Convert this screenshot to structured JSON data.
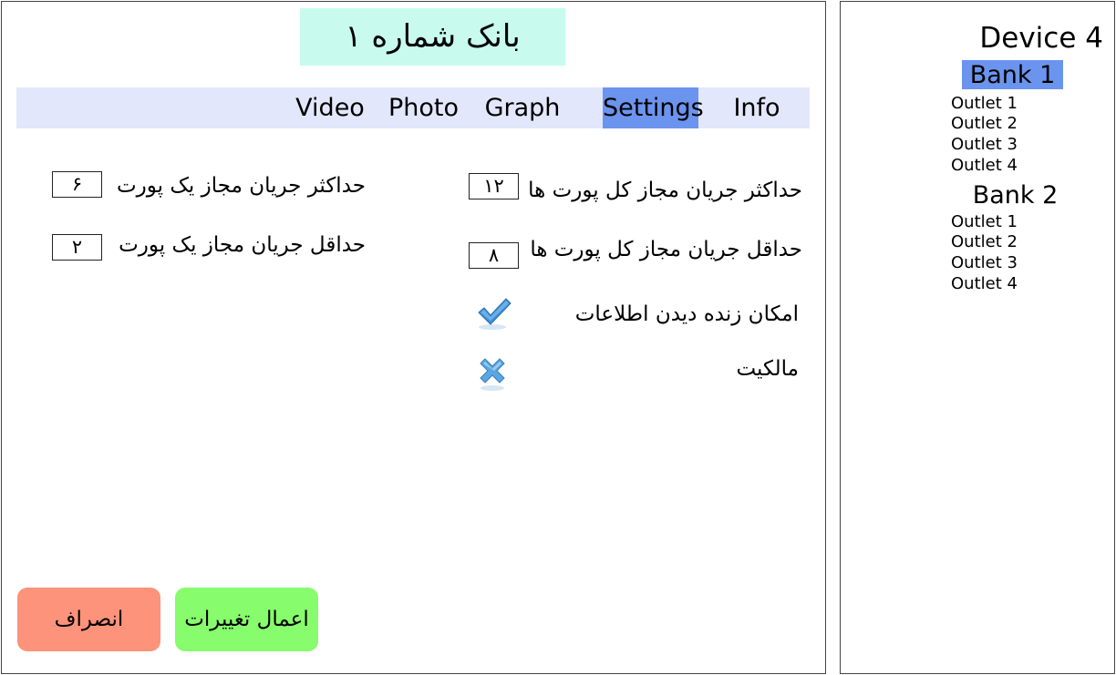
{
  "main": {
    "title": "بانک شماره ۱",
    "tabs": [
      {
        "label": "Video"
      },
      {
        "label": "Photo"
      },
      {
        "label": "Graph"
      },
      {
        "label": "Settings",
        "active": true
      },
      {
        "label": "Info"
      }
    ],
    "settings": {
      "max_total_current_label": "حداکثر جریان مجاز کل پورت ها",
      "max_total_current_value": "۱۲",
      "min_total_current_label": "حداقل جریان مجاز کل پورت ها",
      "min_total_current_value": "۸",
      "max_port_current_label": "حداکثر جریان مجاز یک پورت",
      "max_port_current_value": "۶",
      "min_port_current_label": "حداقل جریان مجاز یک پورت",
      "min_port_current_value": "۲",
      "live_view_label": "امکان زنده دیدن اطلاعات",
      "live_view_enabled": true,
      "ownership_label": "مالکیت",
      "ownership_enabled": false
    },
    "buttons": {
      "cancel_label": "انصراف",
      "apply_label": "اعمال تغییرات"
    }
  },
  "sidebar": {
    "device_title": "Device 4",
    "banks": [
      {
        "label": "Bank 1",
        "active": true,
        "outlets": [
          "Outlet 1",
          "Outlet 2",
          "Outlet 3",
          "Outlet 4"
        ]
      },
      {
        "label": "Bank 2",
        "active": false,
        "outlets": [
          "Outlet 1",
          "Outlet 2",
          "Outlet 3",
          "Outlet 4"
        ]
      }
    ]
  },
  "colors": {
    "title_bg": "#c8fbee",
    "tabbar_bg": "#e3e7fb",
    "active_highlight": "#6b94ee",
    "cancel_bg": "#fd937a",
    "apply_bg": "#87fc6c",
    "check_color": "#3f8fd6",
    "cross_color": "#5aa6e0"
  },
  "icons": {
    "live_view": "check-icon",
    "ownership": "cross-icon"
  }
}
